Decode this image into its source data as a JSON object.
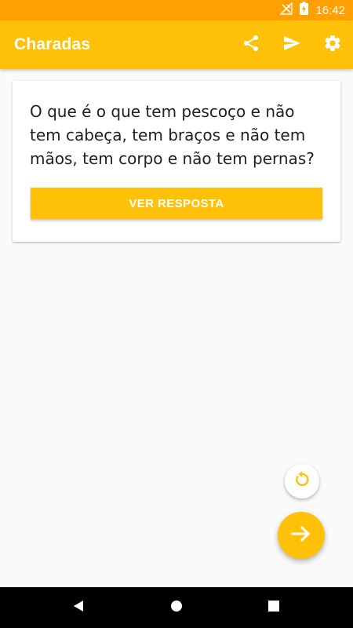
{
  "status_bar": {
    "time": "16:42",
    "icons": [
      "signal-off-icon",
      "battery-charging-icon"
    ]
  },
  "app_bar": {
    "title": "Charadas",
    "actions": [
      "share-icon",
      "send-icon",
      "settings-icon"
    ]
  },
  "riddle": {
    "question": "O que é o que tem pescoço e não tem cabeça, tem braços e não tem mãos, tem corpo e não tem pernas?",
    "answer_button_label": "VER RESPOSTA"
  },
  "buttons": {
    "reset_icon": "refresh-icon",
    "next_icon": "arrow-right-icon"
  },
  "nav_bar": {
    "icons": [
      "back-icon",
      "home-icon",
      "recents-icon"
    ]
  },
  "colors": {
    "status_bar": "#ffa000",
    "primary": "#ffc107",
    "background": "#fafafa",
    "text": "#212121"
  }
}
